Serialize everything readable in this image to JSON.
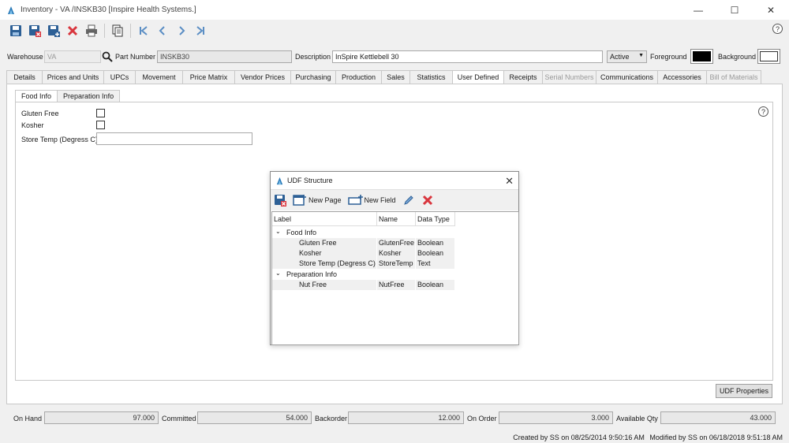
{
  "window": {
    "title": "Inventory - VA   /INSKB30 [Inspire Health Systems.]",
    "minimize": "—",
    "maximize": "☐",
    "close": "✕"
  },
  "toolbar": {
    "help": "?"
  },
  "header": {
    "warehouse_label": "Warehouse",
    "warehouse_value": "VA",
    "part_number_label": "Part Number",
    "part_number_value": "INSKB30",
    "description_label": "Description",
    "description_value": "InSpire Kettlebell 30",
    "status_value": "Active",
    "foreground_label": "Foreground",
    "foreground_color": "#000000",
    "background_label": "Background",
    "background_color": "#ffffff"
  },
  "tabs": [
    {
      "label": "Details"
    },
    {
      "label": "Prices and Units"
    },
    {
      "label": "UPCs"
    },
    {
      "label": "Movement"
    },
    {
      "label": "Price Matrix"
    },
    {
      "label": "Vendor Prices"
    },
    {
      "label": "Purchasing"
    },
    {
      "label": "Production"
    },
    {
      "label": "Sales"
    },
    {
      "label": "Statistics"
    },
    {
      "label": "User Defined"
    },
    {
      "label": "Receipts"
    },
    {
      "label": "Serial Numbers"
    },
    {
      "label": "Communications"
    },
    {
      "label": "Accessories"
    },
    {
      "label": "Bill of Materials"
    }
  ],
  "user_defined": {
    "inner_tabs": [
      {
        "label": "Food Info"
      },
      {
        "label": "Preparation Info"
      }
    ],
    "help": "?",
    "gluten_free_label": "Gluten Free",
    "kosher_label": "Kosher",
    "store_temp_label": "Store Temp (Degress C)",
    "store_temp_value": "",
    "udf_properties_button": "UDF Properties"
  },
  "dialog": {
    "title": "UDF Structure",
    "close": "✕",
    "new_page_label": "New Page",
    "new_field_label": "New Field",
    "columns": {
      "label": "Label",
      "name": "Name",
      "data_type": "Data Type"
    },
    "pages": [
      {
        "label": "Food Info",
        "fields": [
          {
            "label": "Gluten Free",
            "name": "GlutenFree",
            "type": "Boolean"
          },
          {
            "label": "Kosher",
            "name": "Kosher",
            "type": "Boolean"
          },
          {
            "label": "Store Temp (Degress C)",
            "name": "StoreTemp",
            "type": "Text"
          }
        ]
      },
      {
        "label": "Preparation Info",
        "fields": [
          {
            "label": "Nut Free",
            "name": "NutFree",
            "type": "Boolean"
          }
        ]
      }
    ]
  },
  "stats": {
    "on_hand_label": "On Hand",
    "on_hand_value": "97.000",
    "committed_label": "Committed",
    "committed_value": "54.000",
    "backorder_label": "Backorder",
    "backorder_value": "12.000",
    "on_order_label": "On Order",
    "on_order_value": "3.000",
    "available_label": "Available Qty",
    "available_value": "43.000"
  },
  "status_bar": {
    "created": "Created by SS on 08/25/2014 9:50:16 AM",
    "modified": "Modified by SS on 06/18/2018 9:51:18 AM"
  }
}
